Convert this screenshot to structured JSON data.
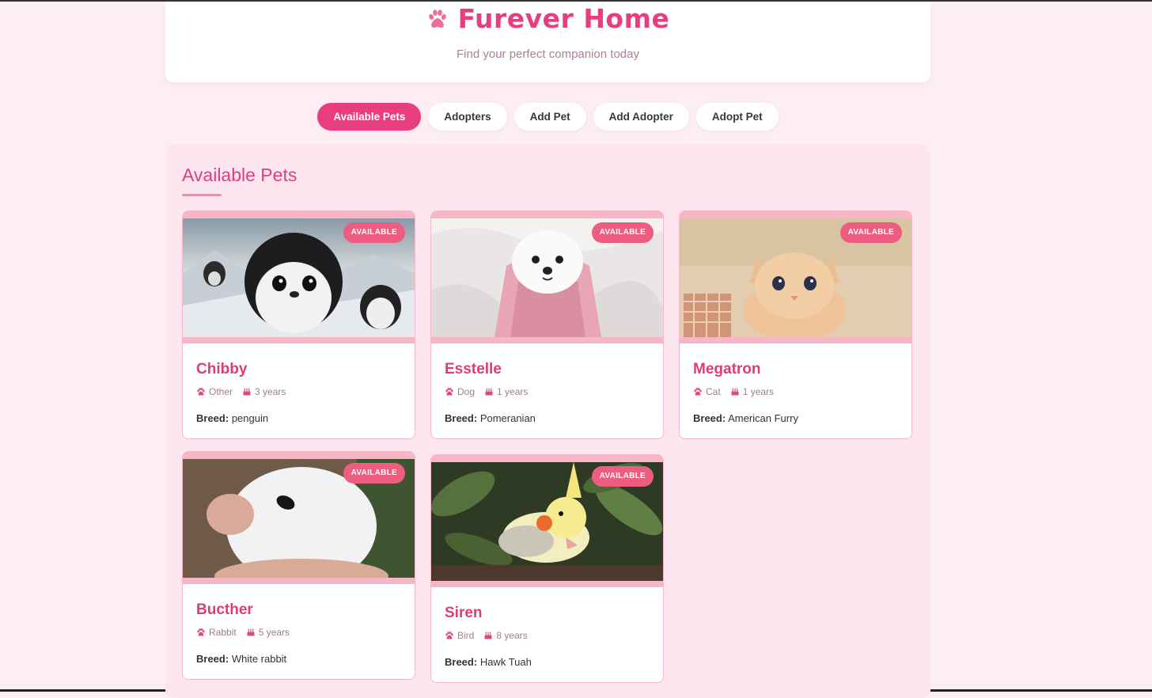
{
  "header": {
    "title": "Furever Home",
    "subtitle": "Find your perfect companion today",
    "icon": "paw-icon"
  },
  "nav": {
    "items": [
      {
        "label": "Available Pets",
        "active": true
      },
      {
        "label": "Adopters",
        "active": false
      },
      {
        "label": "Add Pet",
        "active": false
      },
      {
        "label": "Add Adopter",
        "active": false
      },
      {
        "label": "Adopt Pet",
        "active": false
      }
    ]
  },
  "main": {
    "section_title": "Available Pets",
    "breed_label": "Breed:",
    "pets": [
      {
        "name": "Chibby",
        "type": "Other",
        "age": "3 years",
        "breed": "penguin",
        "status": "AVAILABLE",
        "photo": "penguin-photo"
      },
      {
        "name": "Esstelle",
        "type": "Dog",
        "age": "1 years",
        "breed": "Pomeranian",
        "status": "AVAILABLE",
        "photo": "dog-photo"
      },
      {
        "name": "Megatron",
        "type": "Cat",
        "age": "1 years",
        "breed": "American Furry",
        "status": "AVAILABLE",
        "photo": "kitten-photo"
      },
      {
        "name": "Bucther",
        "type": "Rabbit",
        "age": "5 years",
        "breed": "White rabbit",
        "status": "AVAILABLE",
        "photo": "rabbit-photo"
      },
      {
        "name": "Siren",
        "type": "Bird",
        "age": "8 years",
        "breed": "Hawk Tuah",
        "status": "AVAILABLE",
        "photo": "cockatiel-photo"
      }
    ]
  },
  "colors": {
    "brand": "#e63e7e",
    "background": "#fdeef4",
    "badge": "#ec5d7f"
  }
}
